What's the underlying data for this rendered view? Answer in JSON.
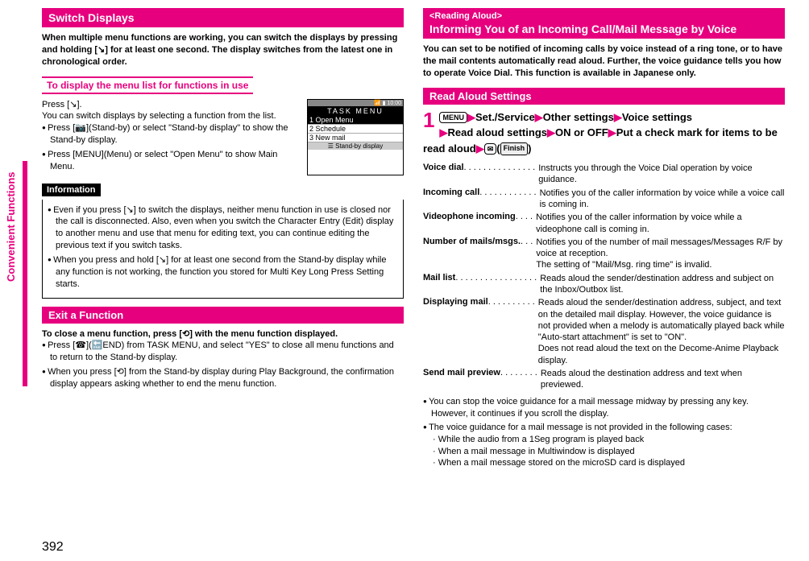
{
  "sideTab": "Convenient Functions",
  "pageNumber": "392",
  "left": {
    "title": "Switch Displays",
    "intro": "When multiple menu functions are working, you can switch the displays by pressing and holding [↘] for at least one second. The display switches from the latest one in chronological order.",
    "sub1": "To display the menu list for functions in use",
    "press1": "Press [↘].",
    "press2": "You can switch displays by selecting a function from the list.",
    "b1": "Press [📷](Stand-by) or select \"Stand-by display\" to show the Stand-by display.",
    "b2": "Press [MENU](Menu) or select \"Open Menu\" to show Main Menu.",
    "mockTop": "📶 ▮ 10:00",
    "mockTitle": "TASK MENU",
    "mockItems": [
      "1 Open Menu",
      "2 Schedule",
      "3 New mail"
    ],
    "mockFoot": "☰ Stand-by display",
    "infoLabel": "Information",
    "i1": "Even if you press [↘] to switch the displays, neither menu function in use is closed nor the call is disconnected. Also, even when you switch the Character Entry (Edit) display to another menu and use that menu for editing text, you can continue editing the previous text if you switch tasks.",
    "i2": "When you press and hold [↘] for at least one second from the Stand-by display while any function is not working, the function you stored for Multi Key Long Press Setting starts.",
    "sub2": "Exit a Function",
    "exit1": "To close a menu function, press [⟲] with the menu function displayed.",
    "e1": "Press [☎](🔚END) from TASK MENU, and select \"YES\" to close all menu functions and to return to the Stand-by display.",
    "e2": "When you press [⟲] from the Stand-by display during Play Background, the confirmation display appears asking whether to end the menu function."
  },
  "right": {
    "tag": "<Reading Aloud>",
    "title": "Informing You of an Incoming Call/Mail Message by Voice",
    "intro": "You can set to be notified of incoming calls by voice instead of a ring tone, or to have the mail contents automatically read aloud. Further, the voice guidance tells you how to operate Voice Dial. This function is available in Japanese only.",
    "sub": "Read Aloud Settings",
    "stepNum": "1",
    "step": "[MENU] ▶ Set./Service ▶ Other settings ▶ Voice settings ▶ Read aloud settings ▶ ON or OFF ▶ Put a check mark for items to be read aloud ▶ [✉](Finish)",
    "settings": [
      {
        "label": "Voice dial",
        "dots": " . . . . . . . . . . . . . . .",
        "desc": "Instructs you through the Voice Dial operation by voice guidance."
      },
      {
        "label": "Incoming call",
        "dots": " . . . . . . . . . . . .",
        "desc": "Notifies you of the caller information by voice while a voice call is coming in."
      },
      {
        "label": "Videophone incoming",
        "dots": " . . . .",
        "desc": "Notifies you of the caller information by voice while a videophone call is coming in."
      },
      {
        "label": "Number of mails/msgs.",
        "dots": " . . .",
        "desc": "Notifies you of the number of mail messages/Messages R/F by voice at reception.\nThe setting of \"Mail/Msg. ring time\" is invalid."
      },
      {
        "label": "Mail list",
        "dots": " . . . . . . . . . . . . . . . . .",
        "desc": "Reads aloud the sender/destination address and subject on the Inbox/Outbox list."
      },
      {
        "label": "Displaying mail",
        "dots": " . . . . . . . . . .",
        "desc": "Reads aloud the sender/destination address, subject, and text on the detailed mail display. However, the voice guidance is not provided when a melody is automatically played back while \"Auto-start attachment\" is set to \"ON\".\nDoes not read aloud the text on the Decome-Anime Playback display."
      },
      {
        "label": "Send mail preview",
        "dots": " . . . . . . . .",
        "desc": "Reads aloud the destination address and text when previewed."
      }
    ],
    "n1": "You can stop the voice guidance for a mail message midway by pressing any key. However, it continues if you scroll the display.",
    "n2": "The voice guidance for a mail message is not provided in the following cases:",
    "n2a": "· While the audio from a 1Seg program is played back",
    "n2b": "· When a mail message in Multiwindow is displayed",
    "n2c": "· When a mail message stored on the microSD card is displayed"
  }
}
